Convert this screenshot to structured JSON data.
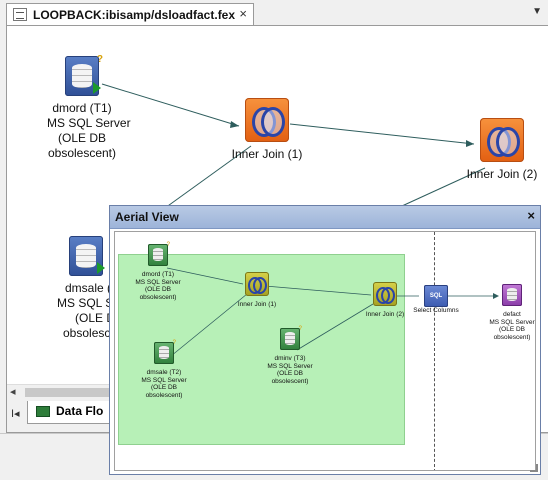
{
  "tab": {
    "title": "LOOPBACK:ibisamp/dsloadfact.fex",
    "close": "×",
    "dropdown": "▼"
  },
  "canvas": {
    "nodes": {
      "dmord": [
        "dmord (T1)",
        "MS SQL Server",
        "(OLE DB",
        "obsolescent)"
      ],
      "dmsale": [
        "dmsale (",
        "MS SQL S",
        "(OLE D",
        "obsolesc"
      ],
      "join1": [
        "Inner Join (1)"
      ],
      "join2": [
        "Inner Join (2)"
      ]
    },
    "scroll_left": "◂",
    "nav_first": "I◂",
    "bottom_tab": "Data Flo"
  },
  "aerial": {
    "title": "Aerial View",
    "close": "×",
    "nodes": {
      "dmord": [
        "dmord (T1)",
        "MS SQL Server",
        "(OLE DB",
        "obsolescent)"
      ],
      "dmsale": [
        "dmsale (T2)",
        "MS SQL Server",
        "(OLE DB",
        "obsolescent)"
      ],
      "dminv": [
        "dminv (T3)",
        "MS SQL Server",
        "(OLE DB",
        "obsolescent)"
      ],
      "join1": [
        "Inner Join (1)"
      ],
      "join2": [
        "Inner Join (2)"
      ],
      "select": [
        "Select Columns"
      ],
      "sql_icon": "SQL",
      "target": [
        "defact",
        "MS SQL Server",
        "(OLE DB",
        "obsolescent)"
      ]
    }
  }
}
